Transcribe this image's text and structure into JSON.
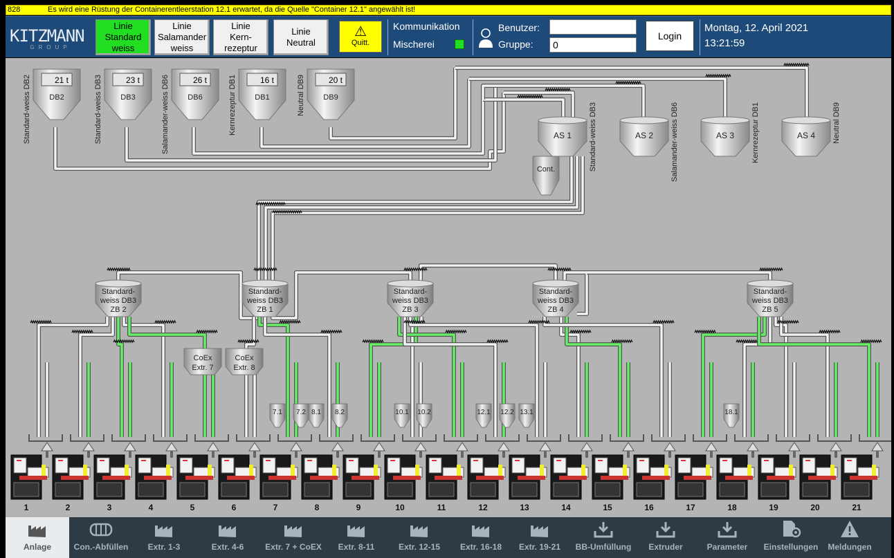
{
  "alarm": {
    "id": "828",
    "text": "Es wird eine Rüstung der Containerentleerstation 12.1 erwartet, da die Quelle \"Container 12.1\" angewählt ist!"
  },
  "header": {
    "logo": {
      "brand": "KITZMANN",
      "sub": "GROUP"
    },
    "line_buttons": [
      {
        "label": "Linie\nStandard\nweiss",
        "active": true
      },
      {
        "label": "Linie\nSalamander\nweiss",
        "active": false
      },
      {
        "label": "Linie\nKern-\nrezeptur",
        "active": false
      },
      {
        "label": "Linie\nNeutral",
        "active": false
      }
    ],
    "ack_label": "Quitt.",
    "comm_label": "Kommunikation",
    "mixer_label": "Mischerei",
    "user_label": "Benutzer:",
    "group_label": "Gruppe:",
    "user_value": "",
    "group_value": "0",
    "login_label": "Login",
    "date": "Montag, 12. April 2021",
    "time": "13:21:59"
  },
  "silos": [
    {
      "label": "DB2",
      "value": "21 t",
      "side": "Standard-weiss DB2"
    },
    {
      "label": "DB3",
      "value": "23 t",
      "side": "Standard-weiss DB3"
    },
    {
      "label": "DB6",
      "value": "26 t",
      "side": "Salamander-weiss DB6"
    },
    {
      "label": "DB1",
      "value": "16 t",
      "side": "Kernrezeptur DB1"
    },
    {
      "label": "DB9",
      "value": "20 t",
      "side": "Neutral DB9"
    }
  ],
  "intermediate": [
    {
      "label": "AS 1",
      "side": "Standard-weiss DB3"
    },
    {
      "label": "AS 2",
      "side": "Salamander-weiss DB6"
    },
    {
      "label": "AS 3",
      "side": "Kernrezeptur DB1"
    },
    {
      "label": "AS 4",
      "side": "Neutral DB9"
    }
  ],
  "container_label": "Cont.",
  "daily_bins": [
    {
      "l1": "Standard-",
      "l2": "weiss DB3",
      "l3": "ZB 2"
    },
    {
      "l1": "Standard-",
      "l2": "weiss DB3",
      "l3": "ZB 1"
    },
    {
      "l1": "Standard-",
      "l2": "weiss DB3",
      "l3": "ZB 3"
    },
    {
      "l1": "Standard-",
      "l2": "weiss DB3",
      "l3": "ZB 4"
    },
    {
      "l1": "Standard-",
      "l2": "weiss DB3",
      "l3": "ZB 5"
    }
  ],
  "coex": [
    {
      "l1": "CoEx",
      "l2": "Extr. 7"
    },
    {
      "l1": "CoEx",
      "l2": "Extr. 8"
    }
  ],
  "small_containers": [
    "7.1",
    "7.2",
    "8.1",
    "8.2",
    "10.1",
    "10.2",
    "12.1",
    "12.2",
    "13.1",
    "18.1"
  ],
  "extruders": [
    "1",
    "2",
    "3",
    "4",
    "5",
    "6",
    "7",
    "8",
    "9",
    "10",
    "11",
    "12",
    "13",
    "14",
    "15",
    "16",
    "17",
    "18",
    "19",
    "20",
    "21"
  ],
  "nav": [
    {
      "label": "Anlage",
      "icon": "factory-icon",
      "active": true
    },
    {
      "label": "Con.-Abfüllen",
      "icon": "container-icon",
      "active": false
    },
    {
      "label": "Extr. 1-3",
      "icon": "factory-icon",
      "active": false
    },
    {
      "label": "Extr. 4-6",
      "icon": "factory-icon",
      "active": false
    },
    {
      "label": "Extr. 7 + CoEX",
      "icon": "factory-icon",
      "active": false
    },
    {
      "label": "Extr. 8-11",
      "icon": "factory-icon",
      "active": false
    },
    {
      "label": "Extr. 12-15",
      "icon": "factory-icon",
      "active": false
    },
    {
      "label": "Extr. 16-18",
      "icon": "factory-icon",
      "active": false
    },
    {
      "label": "Extr. 19-21",
      "icon": "factory-icon",
      "active": false
    },
    {
      "label": "BB-Umfüllung",
      "icon": "download-icon",
      "active": false
    },
    {
      "label": "Extruder",
      "icon": "download-icon",
      "active": false
    },
    {
      "label": "Parameter",
      "icon": "download-icon",
      "active": false
    },
    {
      "label": "Einstellungen",
      "icon": "settings-doc-icon",
      "active": false
    },
    {
      "label": "Meldungen",
      "icon": "warning-icon",
      "active": false
    }
  ],
  "colors": {
    "header": "#1e4a7a",
    "active_green": "#22dd22",
    "alarm_yellow": "#ffff00",
    "pipe_active": "#66ee66",
    "plant_bg": "#b4b4b4"
  }
}
